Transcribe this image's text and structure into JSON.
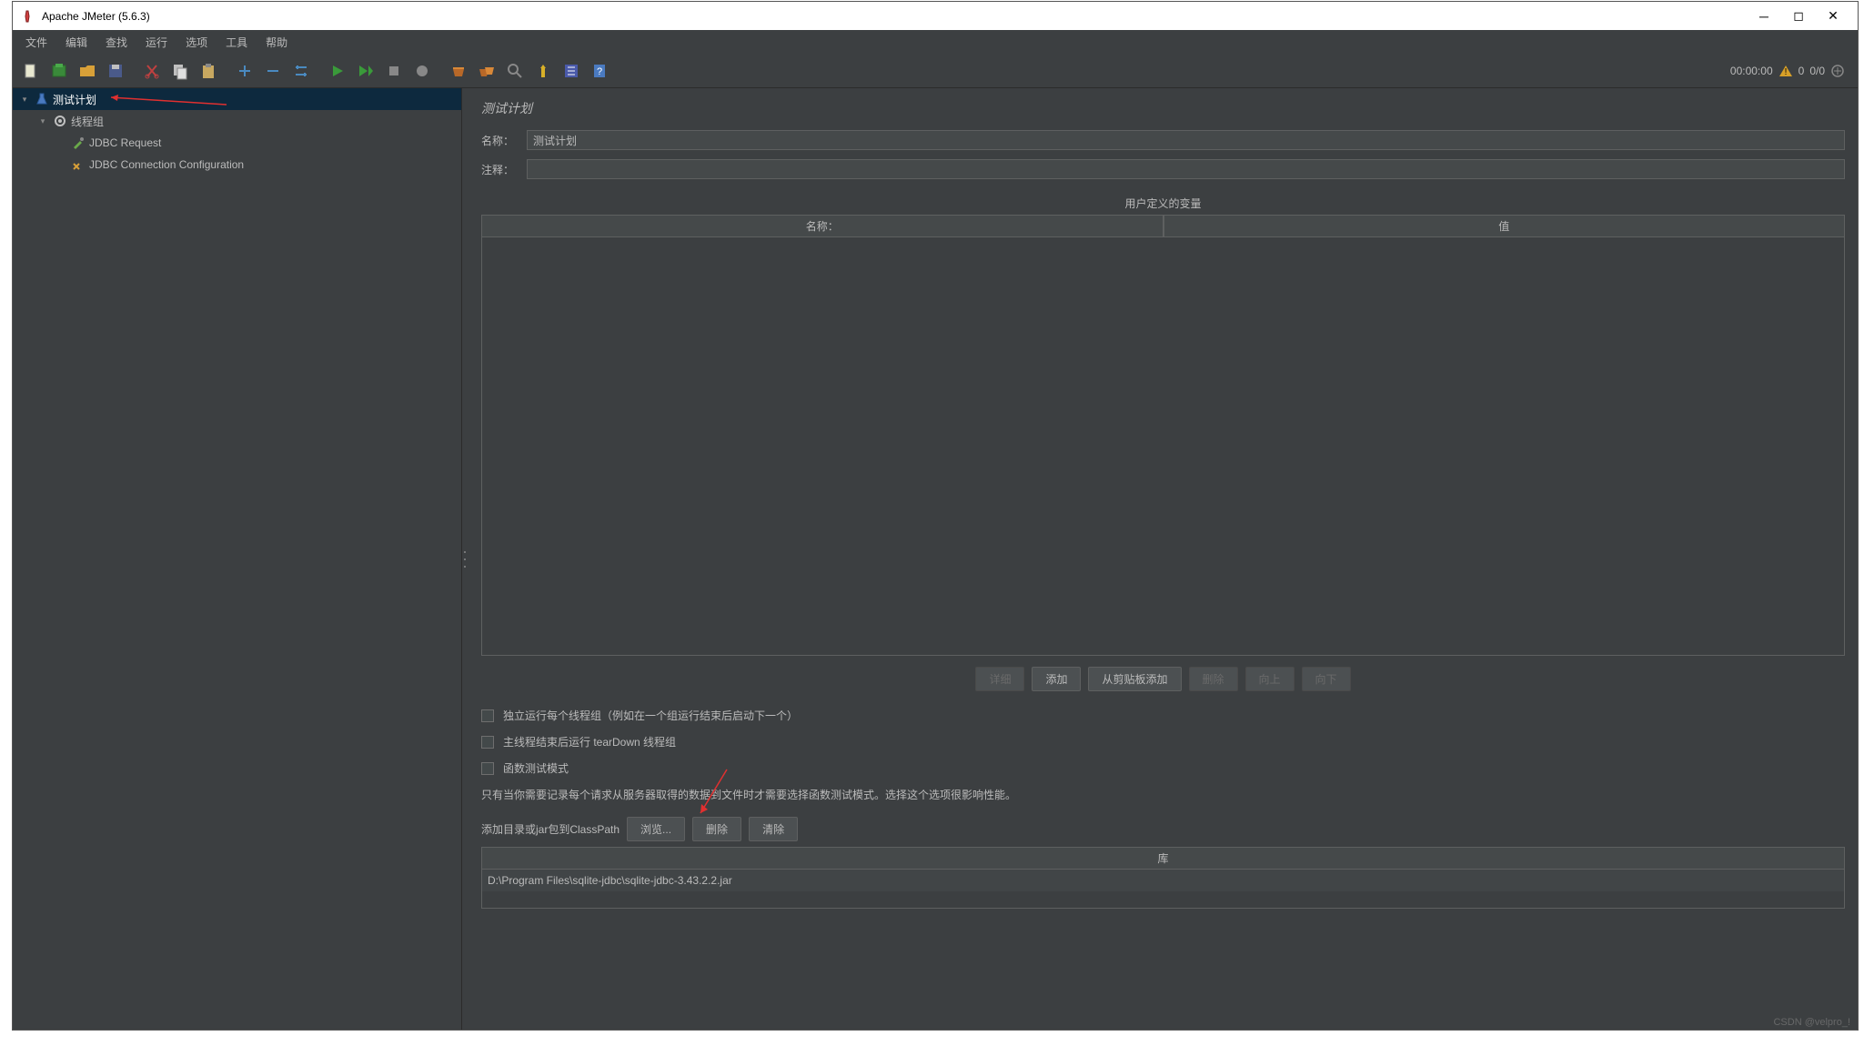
{
  "window": {
    "title": "Apache JMeter (5.6.3)"
  },
  "menu": {
    "file": "文件",
    "edit": "编辑",
    "search": "查找",
    "run": "运行",
    "options": "选项",
    "tools": "工具",
    "help": "帮助"
  },
  "status": {
    "time": "00:00:00",
    "count1": "0",
    "count2": "0/0"
  },
  "tree": {
    "root": "测试计划",
    "group": "线程组",
    "item1": "JDBC Request",
    "item2": "JDBC Connection Configuration"
  },
  "panel": {
    "title": "测试计划",
    "name_label": "名称：",
    "name_value": "测试计划",
    "comment_label": "注释：",
    "vars_header": "用户定义的变量",
    "col_name": "名称：",
    "col_value": "值"
  },
  "buttons": {
    "detail": "详细",
    "add": "添加",
    "add_clip": "从剪贴板添加",
    "delete": "删除",
    "up": "向上",
    "down": "向下",
    "browse": "浏览...",
    "del2": "删除",
    "clear": "清除"
  },
  "checks": {
    "c1": "独立运行每个线程组（例如在一个组运行结束后启动下一个）",
    "c2": "主线程结束后运行 tearDown 线程组",
    "c3": "函数测试模式"
  },
  "help_text": "只有当你需要记录每个请求从服务器取得的数据到文件时才需要选择函数测试模式。选择这个选项很影响性能。",
  "classpath_label": "添加目录或jar包到ClassPath",
  "lib": {
    "header": "库",
    "row": "D:\\Program Files\\sqlite-jdbc\\sqlite-jdbc-3.43.2.2.jar"
  },
  "watermark": "CSDN @velpro_!"
}
